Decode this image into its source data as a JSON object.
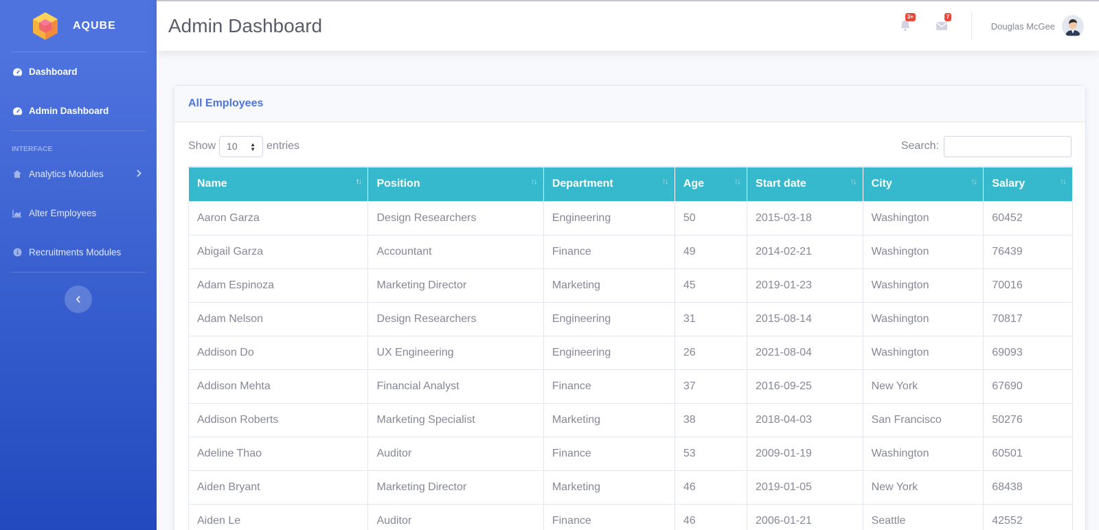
{
  "brand": {
    "name": "AQUBE"
  },
  "sidebar": {
    "items": [
      {
        "label": "Dashboard"
      },
      {
        "label": "Admin Dashboard"
      }
    ],
    "heading": "INTERFACE",
    "interface_items": [
      {
        "label": "Analytics Modules"
      },
      {
        "label": "Alter Employees"
      },
      {
        "label": "Recruitments Modules"
      }
    ]
  },
  "topbar": {
    "title": "Admin Dashboard",
    "alerts_badge": "3+",
    "messages_badge": "7",
    "user_name": "Douglas McGee"
  },
  "card": {
    "title": "All Employees",
    "show_label": "Show",
    "entries_label": "entries",
    "length_value": "10",
    "search_label": "Search:",
    "search_value": ""
  },
  "table": {
    "columns": [
      "Name",
      "Position",
      "Department",
      "Age",
      "Start date",
      "City",
      "Salary"
    ],
    "rows": [
      [
        "Aaron Garza",
        "Design Researchers",
        "Engineering",
        "50",
        "2015-03-18",
        "Washington",
        "60452"
      ],
      [
        "Abigail Garza",
        "Accountant",
        "Finance",
        "49",
        "2014-02-21",
        "Washington",
        "76439"
      ],
      [
        "Adam Espinoza",
        "Marketing Director",
        "Marketing",
        "45",
        "2019-01-23",
        "Washington",
        "70016"
      ],
      [
        "Adam Nelson",
        "Design Researchers",
        "Engineering",
        "31",
        "2015-08-14",
        "Washington",
        "70817"
      ],
      [
        "Addison Do",
        "UX Engineering",
        "Engineering",
        "26",
        "2021-08-04",
        "Washington",
        "69093"
      ],
      [
        "Addison Mehta",
        "Financial Analyst",
        "Finance",
        "37",
        "2016-09-25",
        "New York",
        "67690"
      ],
      [
        "Addison Roberts",
        "Marketing Specialist",
        "Marketing",
        "38",
        "2018-04-03",
        "San Francisco",
        "50276"
      ],
      [
        "Adeline Thao",
        "Auditor",
        "Finance",
        "53",
        "2009-01-19",
        "Washington",
        "60501"
      ],
      [
        "Aiden Bryant",
        "Marketing Director",
        "Marketing",
        "46",
        "2019-01-05",
        "New York",
        "68438"
      ],
      [
        "Aiden Le",
        "Auditor",
        "Finance",
        "46",
        "2006-01-21",
        "Seattle",
        "42552"
      ]
    ]
  },
  "colors": {
    "sidebar": "#4e73df",
    "table_header": "#36b9cc",
    "badge": "#e74a3b"
  }
}
